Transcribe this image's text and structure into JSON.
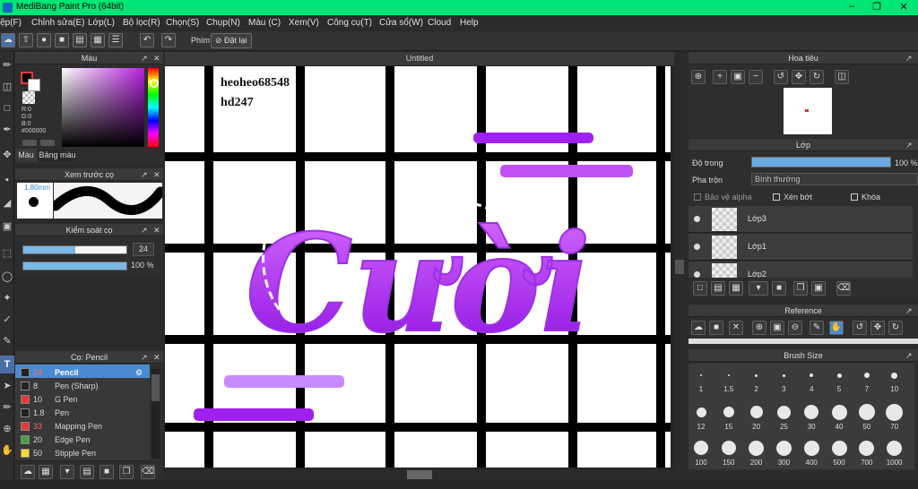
{
  "window": {
    "title": "MediBang Paint Pro (64bit)"
  },
  "menu": [
    "Tệp(F)",
    "Chỉnh sửa(E)",
    "Lớp(L)",
    "Bộ lọc(R)",
    "Chọn(S)",
    "Chụp(N)",
    "Màu (C)",
    "Xem(V)",
    "Công cụ(T)",
    "Cửa sổ(W)",
    "Cloud",
    "Help"
  ],
  "toolbar": {
    "phim_label": "Phím",
    "reset_label": "Đặt lại"
  },
  "color_panel": {
    "title": "Màu",
    "r": "R:0",
    "g": "G:0",
    "b": "B:0",
    "hex": "#000000",
    "tab_color": "Màu",
    "tab_palette": "Bảng màu"
  },
  "brush_preview": {
    "title": "Xem trước cọ",
    "size": "1.80mm"
  },
  "control": {
    "title": "Kiểm soát cọ",
    "size_value": "24",
    "size_fraction": 0.5,
    "opacity_value": "100 %",
    "opacity_fraction": 1.0
  },
  "brush_list": {
    "title": "Cọ: Pencil",
    "items": [
      {
        "size": "24",
        "name": "Pencil",
        "color": "#222222",
        "active": true
      },
      {
        "size": "8",
        "name": "Pen (Sharp)",
        "color": "#222222"
      },
      {
        "size": "10",
        "name": "G Pen",
        "color": "#e53935"
      },
      {
        "size": "1.8",
        "name": "Pen",
        "color": "#222222"
      },
      {
        "size": "33",
        "name": "Mapping Pen",
        "color": "#e53935"
      },
      {
        "size": "20",
        "name": "Edge Pen",
        "color": "#43a047"
      },
      {
        "size": "50",
        "name": "Stipple Pen",
        "color": "#fdd835"
      }
    ]
  },
  "canvas": {
    "tab": "Untitled",
    "text_line1": "heoheo68548",
    "text_line2": "hd247",
    "art_text": "Cười",
    "art_color": "#a020f0"
  },
  "navigator": {
    "title": "Hoa tiêu"
  },
  "layers": {
    "title": "Lớp",
    "opacity_label": "Độ trong",
    "opacity_value": "100 %",
    "opacity_fraction": 1.0,
    "blend_label": "Pha trộn",
    "blend_value": "Bình thường",
    "protect_alpha": "Bảo vệ alpha",
    "clipping": "Xén bớt",
    "lock": "Khóa",
    "items": [
      "Lớp3",
      "Lớp1",
      "Lớp2"
    ]
  },
  "reference": {
    "title": "Reference"
  },
  "brush_size": {
    "title": "Brush Size",
    "sizes": [
      "1",
      "1.5",
      "2",
      "3",
      "4",
      "5",
      "7",
      "10",
      "12",
      "15",
      "20",
      "25",
      "30",
      "40",
      "50",
      "70",
      "100",
      "150",
      "200",
      "300",
      "400",
      "500",
      "700",
      "1000"
    ]
  }
}
